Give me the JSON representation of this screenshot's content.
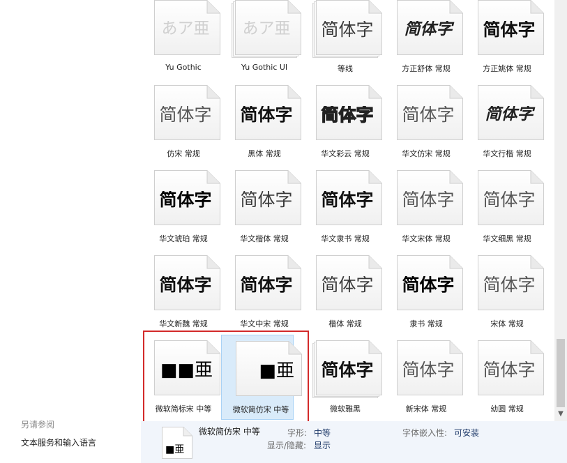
{
  "see_also": {
    "title": "另请参阅",
    "link": "文本服务和输入语言"
  },
  "fonts": [
    {
      "label": "Yu Gothic",
      "sample": "あア亜",
      "style": "faded",
      "stack": false
    },
    {
      "label": "Yu Gothic UI",
      "sample": "あア亜",
      "style": "faded",
      "stack": true
    },
    {
      "label": "等线",
      "sample": "简体字",
      "style": "regular",
      "stack": true
    },
    {
      "label": "方正舒体 常规",
      "sample": "简体字",
      "style": "script",
      "stack": false
    },
    {
      "label": "方正姚体 常规",
      "sample": "简体字",
      "style": "bold",
      "stack": false
    },
    {
      "label": "仿宋 常规",
      "sample": "简体字",
      "style": "light",
      "stack": false
    },
    {
      "label": "黑体 常规",
      "sample": "简体字",
      "style": "bold",
      "stack": false
    },
    {
      "label": "华文彩云 常规",
      "sample": "简体字",
      "style": "outline",
      "stack": false
    },
    {
      "label": "华文仿宋 常规",
      "sample": "简体字",
      "style": "light",
      "stack": false
    },
    {
      "label": "华文行楷 常规",
      "sample": "简体字",
      "style": "script",
      "stack": false
    },
    {
      "label": "华文琥珀 常规",
      "sample": "简体字",
      "style": "heavy",
      "stack": false
    },
    {
      "label": "华文楷体 常规",
      "sample": "简体字",
      "style": "regular",
      "stack": false
    },
    {
      "label": "华文隶书 常规",
      "sample": "简体字",
      "style": "bold",
      "stack": false
    },
    {
      "label": "华文宋体 常规",
      "sample": "简体字",
      "style": "light",
      "stack": false
    },
    {
      "label": "华文细黑 常规",
      "sample": "简体字",
      "style": "light",
      "stack": false
    },
    {
      "label": "华文新魏 常规",
      "sample": "简体字",
      "style": "bold",
      "stack": false
    },
    {
      "label": "华文中宋 常规",
      "sample": "简体字",
      "style": "bold",
      "stack": false
    },
    {
      "label": "楷体 常规",
      "sample": "简体字",
      "style": "regular",
      "stack": false
    },
    {
      "label": "隶书 常规",
      "sample": "简体字",
      "style": "heavy",
      "stack": false
    },
    {
      "label": "宋体 常规",
      "sample": "简体字",
      "style": "light",
      "stack": false
    },
    {
      "label": "微软简标宋 中等",
      "sample": "■■亜",
      "style": "boxes",
      "stack": false
    },
    {
      "label": "微软简仿宋 中等",
      "sample": "■亜",
      "style": "boxes",
      "stack": false,
      "selected": true
    },
    {
      "label": "微软雅黑",
      "sample": "简体字",
      "style": "bold",
      "stack": true
    },
    {
      "label": "新宋体 常规",
      "sample": "简体字",
      "style": "light",
      "stack": false
    },
    {
      "label": "幼圆 常规",
      "sample": "简体字",
      "style": "light",
      "stack": false
    }
  ],
  "details": {
    "name": "微软简仿宋 中等",
    "thumb_sample": "■亜",
    "style_label": "字形:",
    "style_value": "中等",
    "show_label": "显示/隐藏:",
    "show_value": "显示",
    "embed_label": "字体嵌入性:",
    "embed_value": "可安装"
  },
  "scroll": {
    "down_arrow": "▼",
    "position_fraction": 0.85
  },
  "colors": {
    "selection_fill": "#d9ebfa",
    "selection_border": "#a9d2f5",
    "highlight": "#d32a2a",
    "details_bg": "#f1f5fb"
  }
}
